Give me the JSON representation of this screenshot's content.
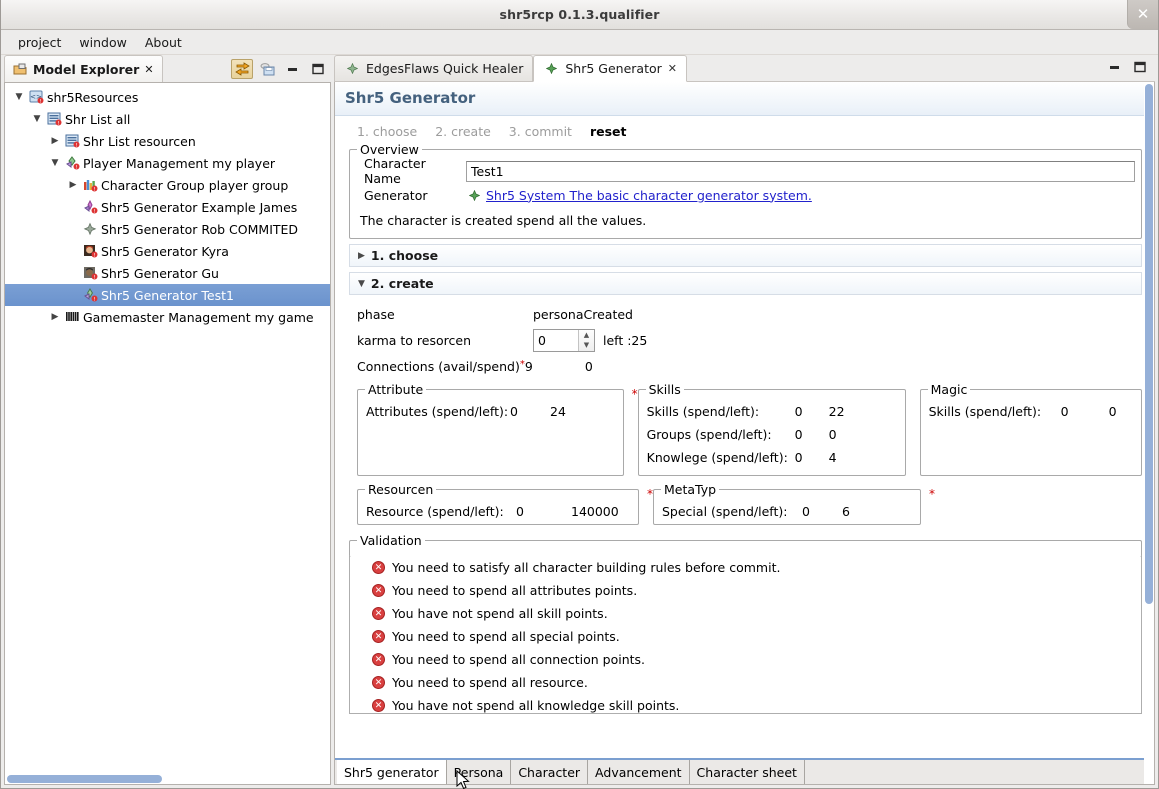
{
  "window": {
    "title": "shr5rcp 0.1.3.qualifier",
    "close_label": "✕"
  },
  "menubar": {
    "items": [
      {
        "label": "project"
      },
      {
        "label": "window"
      },
      {
        "label": "About"
      }
    ]
  },
  "model_explorer": {
    "tab_label": "Model Explorer",
    "tab_icon": "package-icon",
    "close_label": "✕",
    "toolbar": [
      {
        "name": "link-with-editor-icon",
        "pressed": true
      },
      {
        "name": "save-icon",
        "pressed": false
      },
      {
        "name": "minimize-icon",
        "pressed": false
      },
      {
        "name": "maximize-icon",
        "pressed": false
      }
    ],
    "tree": [
      {
        "label": "shr5Resources",
        "indent": 0,
        "twist": "expanded",
        "icon": "resource-icon",
        "selected": false
      },
      {
        "label": "Shr List all",
        "indent": 1,
        "twist": "expanded",
        "icon": "list-icon",
        "selected": false
      },
      {
        "label": "Shr List resourcen",
        "indent": 2,
        "twist": "collapsed",
        "icon": "list-icon",
        "selected": false
      },
      {
        "label": "Player Management my player",
        "indent": 2,
        "twist": "expanded",
        "icon": "player-icon",
        "selected": false
      },
      {
        "label": "Character Group player group",
        "indent": 3,
        "twist": "collapsed",
        "icon": "group-icon",
        "selected": false
      },
      {
        "label": "Shr5 Generator Example James",
        "indent": 3,
        "twist": "none",
        "icon": "generator-pink-icon",
        "selected": false
      },
      {
        "label": "Shr5 Generator Rob COMMITED",
        "indent": 3,
        "twist": "none",
        "icon": "diamond-icon",
        "selected": false
      },
      {
        "label": "Shr5 Generator Kyra",
        "indent": 3,
        "twist": "none",
        "icon": "avatar-kyra-icon",
        "selected": false
      },
      {
        "label": "Shr5 Generator Gu",
        "indent": 3,
        "twist": "none",
        "icon": "avatar-gu-icon",
        "selected": false
      },
      {
        "label": "Shr5 Generator Test1",
        "indent": 3,
        "twist": "none",
        "icon": "generator-icon",
        "selected": true
      },
      {
        "label": "Gamemaster Management my game",
        "indent": 2,
        "twist": "collapsed",
        "icon": "gamemaster-icon",
        "selected": false
      }
    ]
  },
  "editor": {
    "tabs": [
      {
        "label": "EdgesFlaws Quick Healer",
        "active": false,
        "closable": false,
        "icon": "diamond-icon"
      },
      {
        "label": "Shr5 Generator",
        "active": true,
        "closable": true,
        "icon": "diamond-green-icon",
        "close_label": "✕"
      }
    ],
    "minimize_label": "minimize-icon",
    "maximize_label": "maximize-icon",
    "form_title": "Shr5 Generator",
    "steps": [
      {
        "label": "1. choose",
        "state": "dim"
      },
      {
        "label": "2. create",
        "state": "dim"
      },
      {
        "label": "3. commit",
        "state": "dim"
      },
      {
        "label": "reset",
        "state": "active"
      }
    ],
    "overview": {
      "legend": "Overview",
      "character_name_label": "Character Name",
      "character_name_value": "Test1",
      "character_name_placeholder": "",
      "generator_label": "Generator",
      "generator_link": "Shr5 System The basic character generator system.",
      "description": "The character is created spend all the values."
    },
    "sections": [
      {
        "label": "1. choose",
        "expanded": false
      },
      {
        "label": "2. create",
        "expanded": true
      }
    ],
    "create": {
      "phase_label": "phase",
      "phase_value": "personaCreated",
      "karma_label": "karma to resorcen",
      "karma_value": "0",
      "karma_left": "left :25",
      "connections_label": "Connections (avail/spend)",
      "connections_required": "*",
      "connections_avail": "9",
      "connections_spend": "0"
    },
    "groups": [
      {
        "legend": "Attribute",
        "required": false,
        "rows": [
          {
            "name": "Attributes (spend/left):",
            "v1": "0",
            "v2": "24"
          }
        ]
      },
      {
        "legend": "Skills",
        "required": true,
        "rows": [
          {
            "name": "Skills (spend/left):",
            "v1": "0",
            "v2": "22"
          },
          {
            "name": "Groups (spend/left):",
            "v1": "0",
            "v2": "0"
          },
          {
            "name": "Knowlege (spend/left):",
            "v1": "0",
            "v2": "4"
          }
        ]
      },
      {
        "legend": "Magic",
        "required": false,
        "rows": [
          {
            "name": "Skills (spend/left):",
            "v1": "0",
            "v2": "0"
          }
        ]
      },
      {
        "legend": "Resourcen",
        "required": false,
        "rows": [
          {
            "name": "Resource (spend/left):",
            "v1": "0",
            "v2": "140000"
          }
        ]
      },
      {
        "legend": "MetaTyp",
        "required": true,
        "trailing_required": true,
        "rows": [
          {
            "name": "Special (spend/left):",
            "v1": "0",
            "v2": "6"
          }
        ]
      }
    ],
    "validation": {
      "legend": "Validation",
      "errors": [
        "You need to satisfy all character building rules before commit.",
        "You need to spend all attributes points.",
        "You have not spend all skill points.",
        "You need to spend all special points.",
        "You need to spend all connection points.",
        "You need to spend all resource.",
        "You have not spend all knowledge skill points."
      ]
    },
    "page_tabs": [
      {
        "label": "Shr5 generator",
        "active": true
      },
      {
        "label": "Persona",
        "active": false
      },
      {
        "label": "Character",
        "active": false
      },
      {
        "label": "Advancement",
        "active": false
      },
      {
        "label": "Character sheet",
        "active": false
      }
    ]
  },
  "colors": {
    "selection": "#6b93cd",
    "link": "#2222cc",
    "error": "#d94040",
    "heading": "#44617e",
    "required": "#cc0000"
  }
}
